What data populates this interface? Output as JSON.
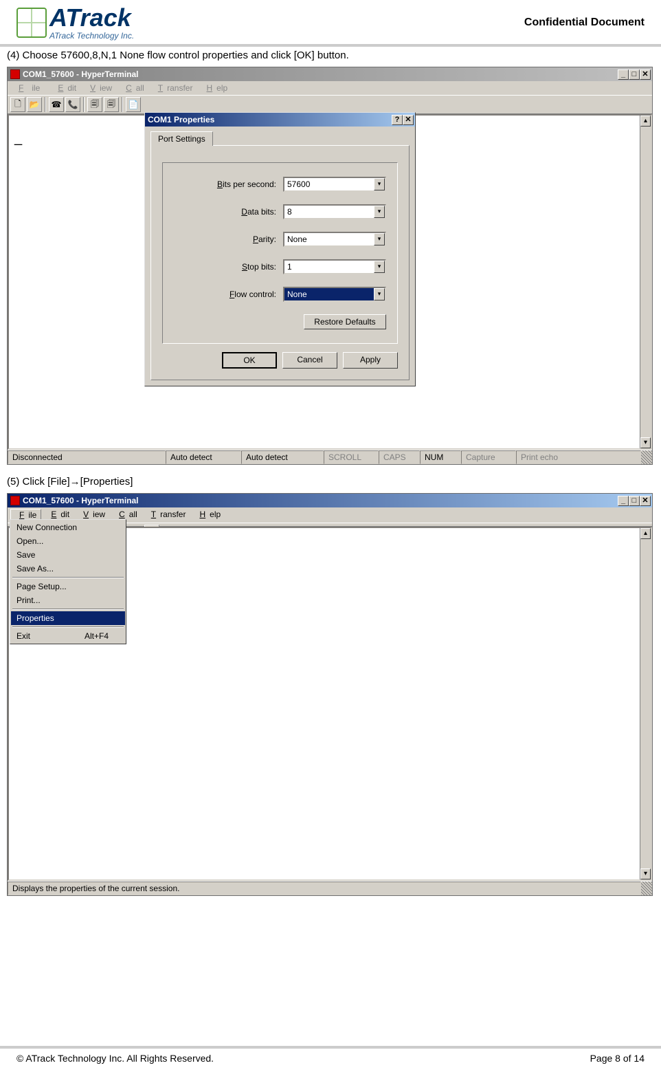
{
  "header": {
    "logo_main": "ATrack",
    "logo_sub": "ATrack Technology Inc.",
    "confidential": "Confidential Document"
  },
  "step4": "(4) Choose 57600,8,N,1 None flow control properties and click [OK] button.",
  "step5": "(5) Click [File]→[Properties]",
  "win1": {
    "title": "COM1_57600 - HyperTerminal",
    "menus": [
      "File",
      "Edit",
      "View",
      "Call",
      "Transfer",
      "Help"
    ],
    "status": [
      "Disconnected",
      "Auto detect",
      "Auto detect",
      "SCROLL",
      "CAPS",
      "NUM",
      "Capture",
      "Print echo"
    ]
  },
  "dialog": {
    "title": "COM1  Properties",
    "tab": "Port Settings",
    "fields": {
      "bits_per_second": {
        "label": "Bits per second:",
        "value": "57600"
      },
      "data_bits": {
        "label": "Data bits:",
        "value": "8"
      },
      "parity": {
        "label": "Parity:",
        "value": "None"
      },
      "stop_bits": {
        "label": "Stop bits:",
        "value": "1"
      },
      "flow_control": {
        "label": "Flow control:",
        "value": "None"
      }
    },
    "restore": "Restore Defaults",
    "ok": "OK",
    "cancel": "Cancel",
    "apply": "Apply"
  },
  "win2": {
    "title": "COM1_57600 - HyperTerminal",
    "menus": [
      "File",
      "Edit",
      "View",
      "Call",
      "Transfer",
      "Help"
    ],
    "file_menu": [
      "New Connection",
      "Open...",
      "Save",
      "Save As...",
      "|",
      "Page Setup...",
      "Print...",
      "|",
      "Properties",
      "|",
      "Exit"
    ],
    "file_menu_shortcut_exit": "Alt+F4",
    "status": "Displays the properties of the current session."
  },
  "footer": {
    "left": "© ATrack Technology Inc. All Rights Reserved.",
    "right": "Page 8 of 14"
  }
}
